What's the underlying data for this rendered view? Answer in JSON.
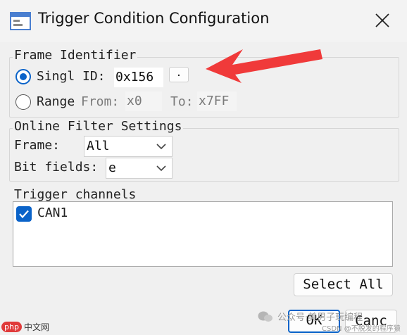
{
  "window": {
    "title": "Trigger Condition Configuration",
    "icon": "app-window-icon"
  },
  "frame_identifier": {
    "legend": "Frame Identifier",
    "single_label": "Singl",
    "range_label": "Range",
    "selected": "single",
    "id_label": "ID:",
    "id_value": "0x156",
    "id_button_label": ".",
    "from_label": "From:",
    "from_value": "x0",
    "to_label": "To:",
    "to_value": "x7FF"
  },
  "online_filter": {
    "legend": "Online Filter Settings",
    "frame_label": "Frame:",
    "frame_value": "All",
    "bitfields_label": "Bit fields:",
    "bitfields_value": "e"
  },
  "trigger_channels": {
    "legend": "Trigger channels",
    "channels": [
      {
        "label": "CAN1",
        "checked": true
      }
    ]
  },
  "buttons": {
    "select_all": "Select All",
    "ok": "OK",
    "cancel": "Canc"
  },
  "watermark": {
    "wechat_text": "公众号·美男子玩编程",
    "csdn_text": "CSDN @不脱发的程序猿",
    "php_badge": "php",
    "php_text": "中文网"
  },
  "colors": {
    "accent": "#0a63c9",
    "annotation_arrow": "#f03a3a",
    "window_bg": "#f0f0f0"
  }
}
